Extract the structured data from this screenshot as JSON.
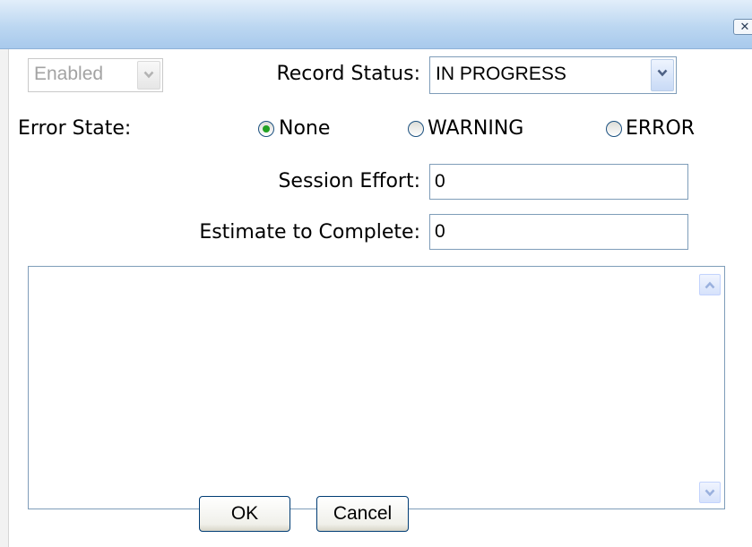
{
  "window": {
    "close_glyph": "✕",
    "close_icon": "close-icon"
  },
  "form": {
    "enabled_select": {
      "value": "Enabled",
      "disabled": true
    },
    "record_status": {
      "label": "Record Status:",
      "value": "IN PROGRESS"
    },
    "error_state": {
      "label": "Error State:",
      "options": [
        {
          "label": "None",
          "checked": true
        },
        {
          "label": "WARNING",
          "checked": false
        },
        {
          "label": "ERROR",
          "checked": false
        }
      ]
    },
    "session_effort": {
      "label": "Session Effort:",
      "value": "0"
    },
    "estimate_to_complete": {
      "label": "Estimate to Complete:",
      "value": "0"
    },
    "notes": {
      "value": ""
    }
  },
  "buttons": {
    "ok": "OK",
    "cancel": "Cancel"
  },
  "colors": {
    "titlebar": "#bcd7f1",
    "radio_checked": "#21a121",
    "border": "#7f9db9"
  }
}
